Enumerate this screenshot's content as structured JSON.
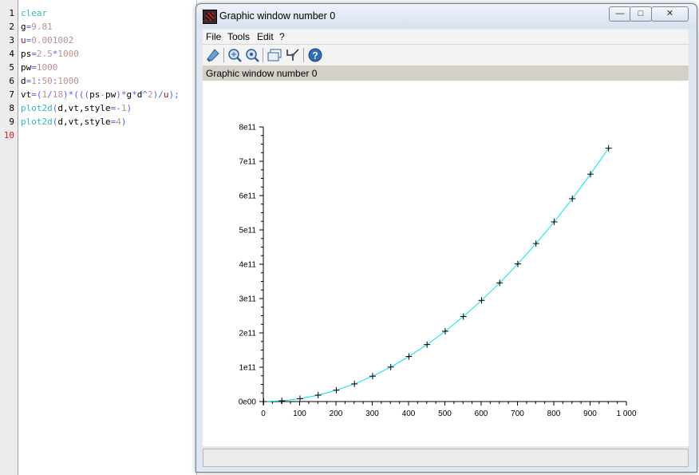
{
  "editor": {
    "line_numbers": [
      "1",
      "2",
      "3",
      "4",
      "5",
      "6",
      "7",
      "8",
      "9",
      "10"
    ],
    "lines": [
      [
        {
          "t": "clear",
          "c": "kw"
        }
      ],
      [
        {
          "t": "g",
          "c": "plain"
        },
        {
          "t": "=",
          "c": "op"
        },
        {
          "t": "9.81",
          "c": "num"
        }
      ],
      [
        {
          "t": "u",
          "c": "var"
        },
        {
          "t": "=",
          "c": "op"
        },
        {
          "t": "0.001002",
          "c": "num"
        }
      ],
      [
        {
          "t": "ps",
          "c": "plain"
        },
        {
          "t": "=",
          "c": "op"
        },
        {
          "t": "2.5",
          "c": "num"
        },
        {
          "t": "*",
          "c": "op"
        },
        {
          "t": "1000",
          "c": "num"
        }
      ],
      [
        {
          "t": "pw",
          "c": "plain"
        },
        {
          "t": "=",
          "c": "op"
        },
        {
          "t": "1000",
          "c": "num"
        }
      ],
      [
        {
          "t": "d",
          "c": "plain"
        },
        {
          "t": "=",
          "c": "op"
        },
        {
          "t": "1",
          "c": "num"
        },
        {
          "t": ":",
          "c": "op"
        },
        {
          "t": "50",
          "c": "num"
        },
        {
          "t": ":",
          "c": "op"
        },
        {
          "t": "1000",
          "c": "num"
        }
      ],
      [
        {
          "t": "vt",
          "c": "plain"
        },
        {
          "t": "=(",
          "c": "op"
        },
        {
          "t": "1",
          "c": "num"
        },
        {
          "t": "/",
          "c": "op"
        },
        {
          "t": "18",
          "c": "num"
        },
        {
          "t": ")*(((",
          "c": "op"
        },
        {
          "t": "ps",
          "c": "plain"
        },
        {
          "t": "-",
          "c": "op"
        },
        {
          "t": "pw",
          "c": "plain"
        },
        {
          "t": ")*",
          "c": "op"
        },
        {
          "t": "g",
          "c": "plain"
        },
        {
          "t": "*",
          "c": "op"
        },
        {
          "t": "d",
          "c": "plain"
        },
        {
          "t": "^",
          "c": "op"
        },
        {
          "t": "2",
          "c": "num"
        },
        {
          "t": ")/",
          "c": "op"
        },
        {
          "t": "u",
          "c": "var"
        },
        {
          "t": ");",
          "c": "op"
        }
      ],
      [
        {
          "t": "plot2d",
          "c": "kw"
        },
        {
          "t": "(",
          "c": "op"
        },
        {
          "t": "d",
          "c": "plain"
        },
        {
          "t": ",",
          "c": "plain"
        },
        {
          "t": "vt",
          "c": "plain"
        },
        {
          "t": ",",
          "c": "plain"
        },
        {
          "t": "style",
          "c": "plain"
        },
        {
          "t": "=-",
          "c": "op"
        },
        {
          "t": "1",
          "c": "num"
        },
        {
          "t": ")",
          "c": "op"
        }
      ],
      [
        {
          "t": "plot2d",
          "c": "kw"
        },
        {
          "t": "(",
          "c": "op"
        },
        {
          "t": "d",
          "c": "plain"
        },
        {
          "t": ",",
          "c": "plain"
        },
        {
          "t": "vt",
          "c": "plain"
        },
        {
          "t": ",",
          "c": "plain"
        },
        {
          "t": "style",
          "c": "plain"
        },
        {
          "t": "=",
          "c": "op"
        },
        {
          "t": "4",
          "c": "num"
        },
        {
          "t": ")",
          "c": "op"
        }
      ],
      []
    ],
    "current_line_color": "#cc2222"
  },
  "window": {
    "title": "Graphic window number 0",
    "controls": {
      "minimize": "—",
      "maximize": "□",
      "close": "✕"
    },
    "menus": [
      "File",
      "Tools",
      "Edit",
      "?"
    ],
    "toolbar_icons": [
      "datatip-icon",
      "zoom-in-icon",
      "zoom-out-icon",
      "new-window-icon",
      "rotate-axes-icon",
      "help-icon"
    ],
    "info_text": "Graphic window number 0",
    "status_text": ""
  },
  "chart_data": {
    "type": "line",
    "title": "",
    "xlabel": "",
    "ylabel": "",
    "xlim": [
      0,
      1000
    ],
    "ylim": [
      0,
      800000000000.0
    ],
    "x_ticks": [
      "0",
      "100",
      "200",
      "300",
      "400",
      "500",
      "600",
      "700",
      "800",
      "900",
      "1 000"
    ],
    "y_ticks": [
      "0e00",
      "1e11",
      "2e11",
      "3e11",
      "4e11",
      "5e11",
      "6e11",
      "7e11",
      "8e11"
    ],
    "grid": false,
    "series": [
      {
        "style": "line+cross-markers",
        "line_color": "#00e5e5",
        "marker_color": "#000000",
        "x": [
          1,
          51,
          101,
          151,
          201,
          251,
          301,
          351,
          401,
          451,
          501,
          551,
          601,
          651,
          701,
          751,
          801,
          851,
          901,
          951
        ],
        "y": [
          816000.0,
          2120000000.0,
          8330000000.0,
          18600000000.0,
          33000000000.0,
          51400000000.0,
          73900000000.0,
          100500000000.0,
          131200000000.0,
          166000000000.0,
          204800000000.0,
          247700000000.0,
          294700000000.0,
          345800000000.0,
          400900000000.0,
          460200000000.0,
          523500000000.0,
          590900000000.0,
          662400000000.0,
          738000000000.0
        ]
      }
    ]
  }
}
